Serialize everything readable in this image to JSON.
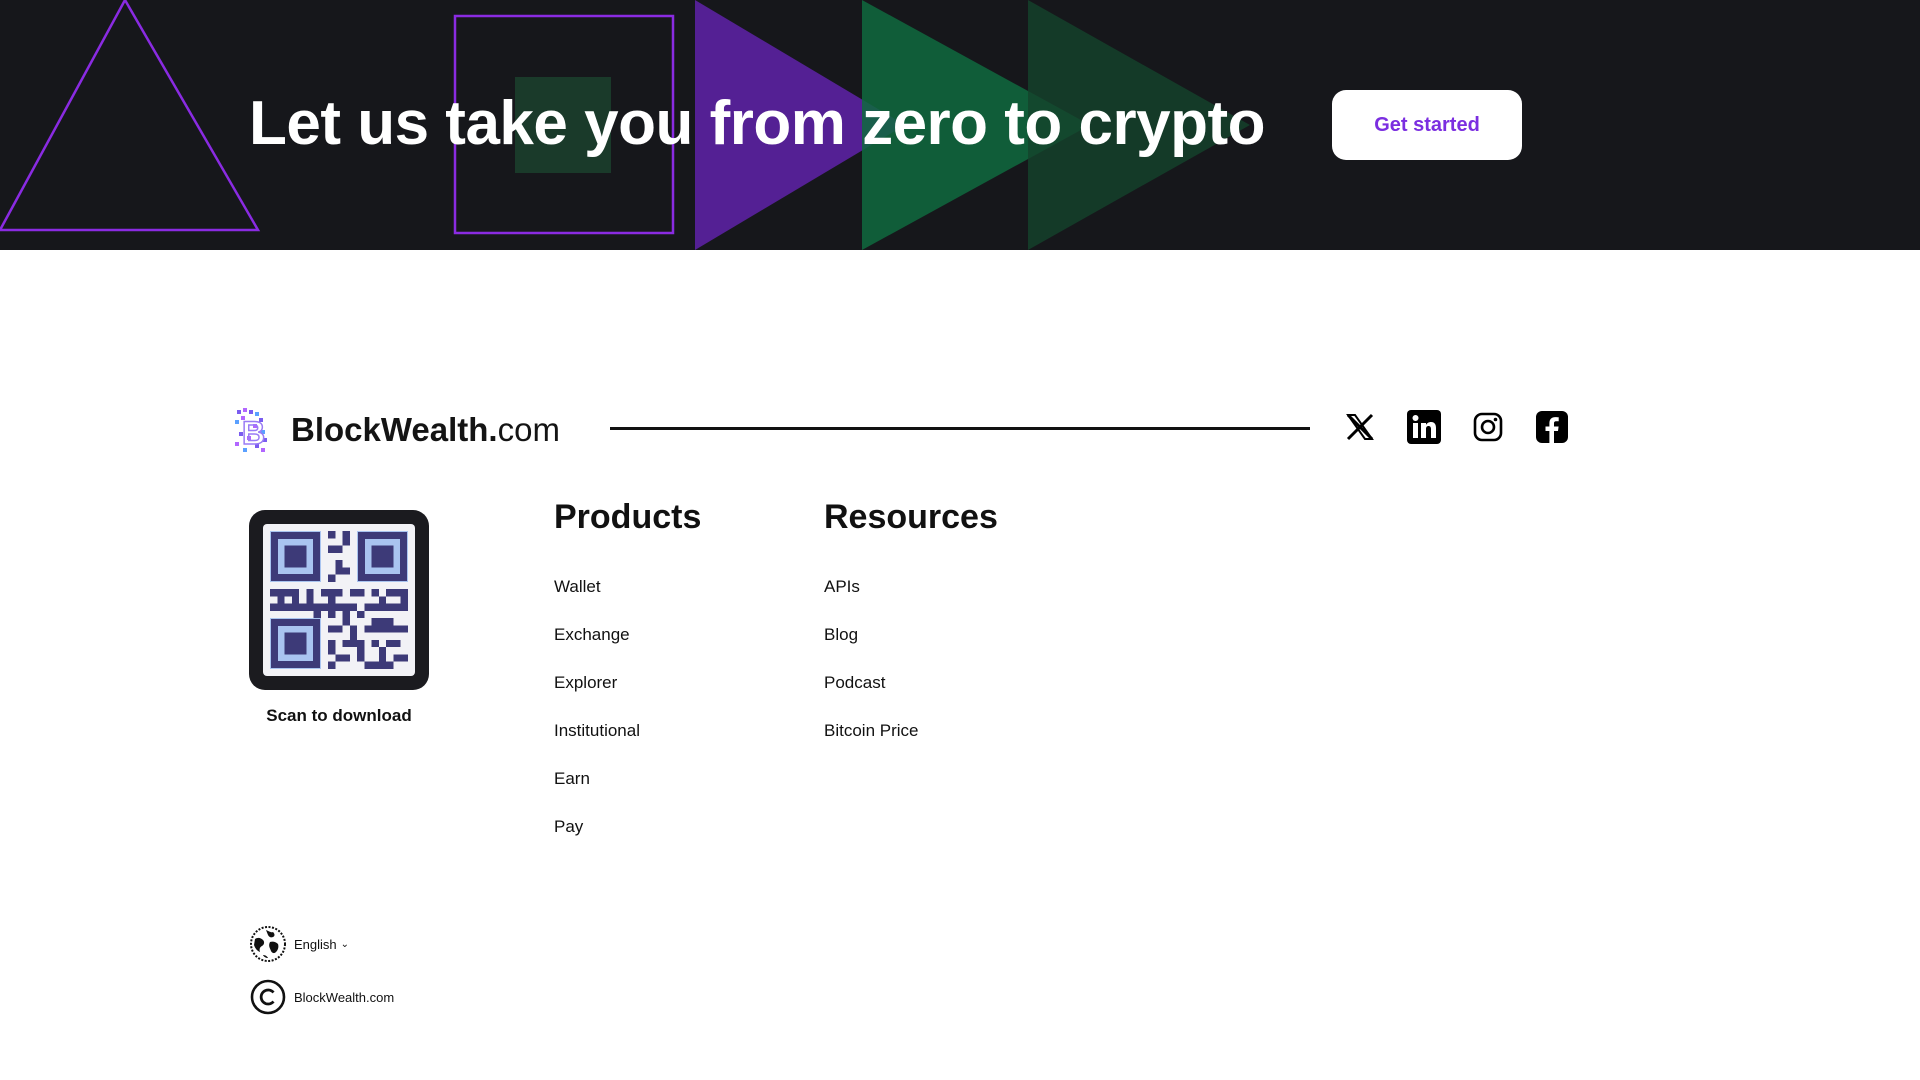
{
  "hero": {
    "title": "Let us take you from zero to crypto",
    "cta_label": "Get started"
  },
  "brand": {
    "name_bold": "BlockWealth.",
    "name_light": "com"
  },
  "socials": [
    {
      "icon": "x-icon"
    },
    {
      "icon": "linkedin-icon"
    },
    {
      "icon": "instagram-icon"
    },
    {
      "icon": "facebook-icon"
    }
  ],
  "qr": {
    "caption": "Scan to download"
  },
  "products": {
    "heading": "Products",
    "items": [
      "Wallet",
      "Exchange",
      "Explorer",
      "Institutional",
      "Earn",
      "Pay"
    ]
  },
  "resources": {
    "heading": "Resources",
    "items": [
      "APIs",
      "Blog",
      "Podcast",
      "Bitcoin Price"
    ]
  },
  "language": {
    "label": "English",
    "chevron": "⌄"
  },
  "copyright": {
    "label": "BlockWealth.com"
  },
  "colors": {
    "hero_bg": "#16171b",
    "accent_purple": "#7b2ee0",
    "accent_green": "#0f7a45"
  }
}
